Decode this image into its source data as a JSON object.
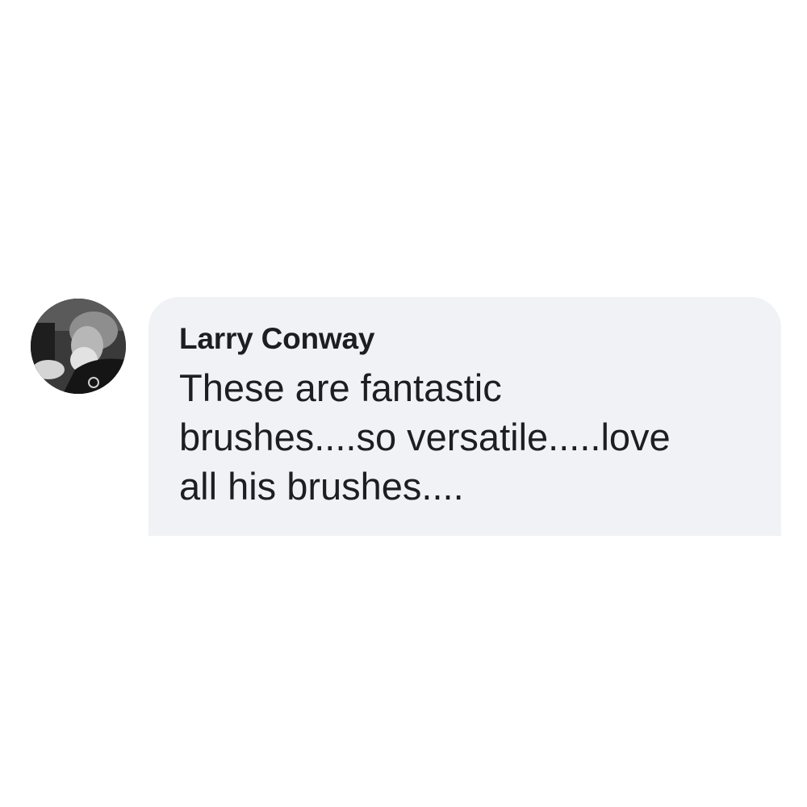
{
  "comment": {
    "author": "Larry Conway",
    "text": "These are fantastic\nbrushes....so versatile.....love\nall his brushes....",
    "avatar_icon": "profile-photo",
    "bubble_color": "#f0f2f5",
    "text_color": "#1c1e21"
  }
}
